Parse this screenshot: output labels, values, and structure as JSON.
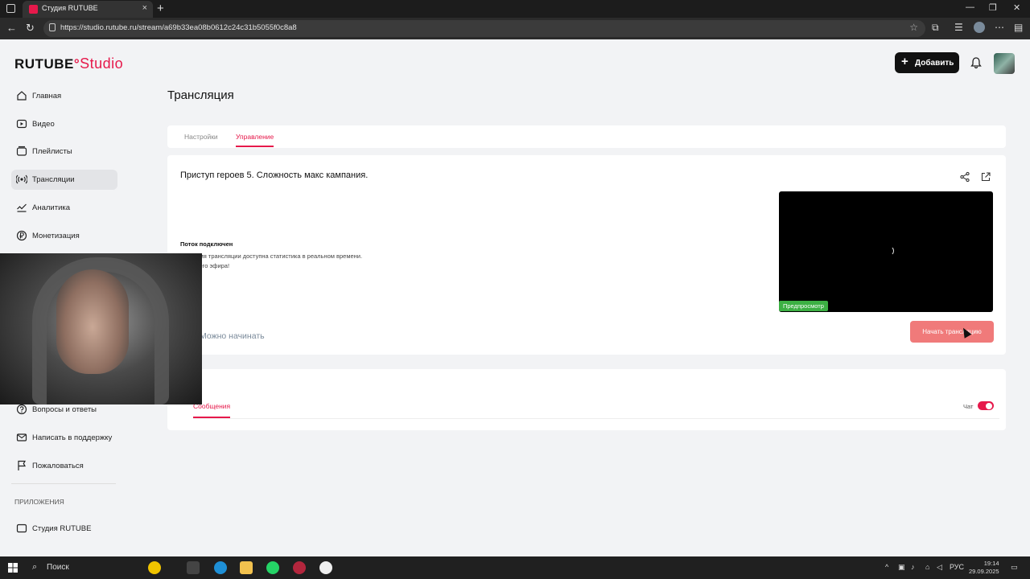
{
  "browser": {
    "tab_title": "Студия RUTUBE",
    "url": "https://studio.rutube.ru/stream/a69b33ea08b0612c24c31b5055f0c8a8"
  },
  "header": {
    "logo_text": "RUTUBE",
    "logo_suffix": "Studio",
    "add_label": "Добавить"
  },
  "sidebar": {
    "items": [
      {
        "label": "Главная",
        "icon": "home-icon"
      },
      {
        "label": "Видео",
        "icon": "video-icon"
      },
      {
        "label": "Плейлисты",
        "icon": "playlist-icon"
      },
      {
        "label": "Трансляции",
        "icon": "broadcast-icon",
        "active": true
      },
      {
        "label": "Аналитика",
        "icon": "analytics-icon"
      },
      {
        "label": "Монетизация",
        "icon": "ruble-icon"
      },
      {
        "label": "Вопросы и ответы",
        "icon": "question-icon"
      },
      {
        "label": "Написать в поддержку",
        "icon": "mail-icon"
      },
      {
        "label": "Пожаловаться",
        "icon": "flag-icon"
      }
    ],
    "section_apps": "ПРИЛОЖЕНИЯ",
    "apps": [
      {
        "label": "Студия RUTUBE",
        "icon": "studio-icon"
      }
    ]
  },
  "main": {
    "page_title": "Трансляция",
    "tabs": [
      {
        "label": "Настройки"
      },
      {
        "label": "Управление",
        "active": true
      }
    ],
    "stream": {
      "title": "Приступ героев 5. Сложность макс кампания.",
      "status_heading": "Поток подключен",
      "status_line1": "Во время трансляции доступна статистика в реальном времени.",
      "status_line2": "Хорошего эфира!",
      "can_start": "Можно начинать",
      "preview_badge": "Предпросмотр",
      "start_button": "Начать трансляцию"
    },
    "chat": {
      "tab_label": "Сообщения",
      "toggle_label": "Чат",
      "toggle_on": true
    }
  },
  "taskbar": {
    "search_label": "Поиск",
    "lang": "РУС",
    "time": "19:14",
    "date": "29.09.2025"
  },
  "colors": {
    "accent": "#e6194b",
    "start_button": "#f07a7a",
    "preview_badge": "#3cb043",
    "fab": "#2aa3a3"
  }
}
